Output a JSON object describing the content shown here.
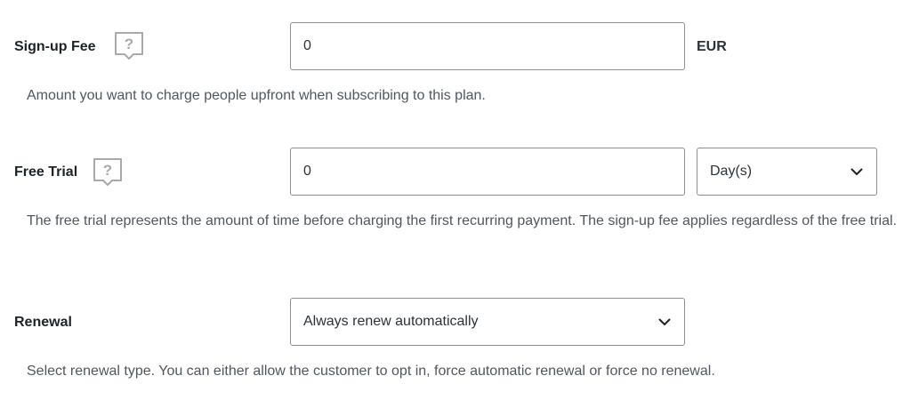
{
  "signup_fee": {
    "label": "Sign-up Fee",
    "help_icon": "question-bubble-icon",
    "value": "0",
    "currency": "EUR",
    "description": "Amount you want to charge people upfront when subscribing to this plan."
  },
  "free_trial": {
    "label": "Free Trial",
    "help_icon": "question-bubble-icon",
    "value": "0",
    "unit_selected": "Day(s)",
    "description": "The free trial represents the amount of time before charging the first recurring payment. The sign-up fee applies regardless of the free trial."
  },
  "renewal": {
    "label": "Renewal",
    "selected": "Always renew automatically",
    "description": "Select renewal type. You can either allow the customer to opt in, force automatic renewal or force no renewal."
  },
  "colors": {
    "border": "#8c8f94",
    "label_text": "#1d2327",
    "description_text": "#50575e",
    "icon": "#a7aaad"
  }
}
